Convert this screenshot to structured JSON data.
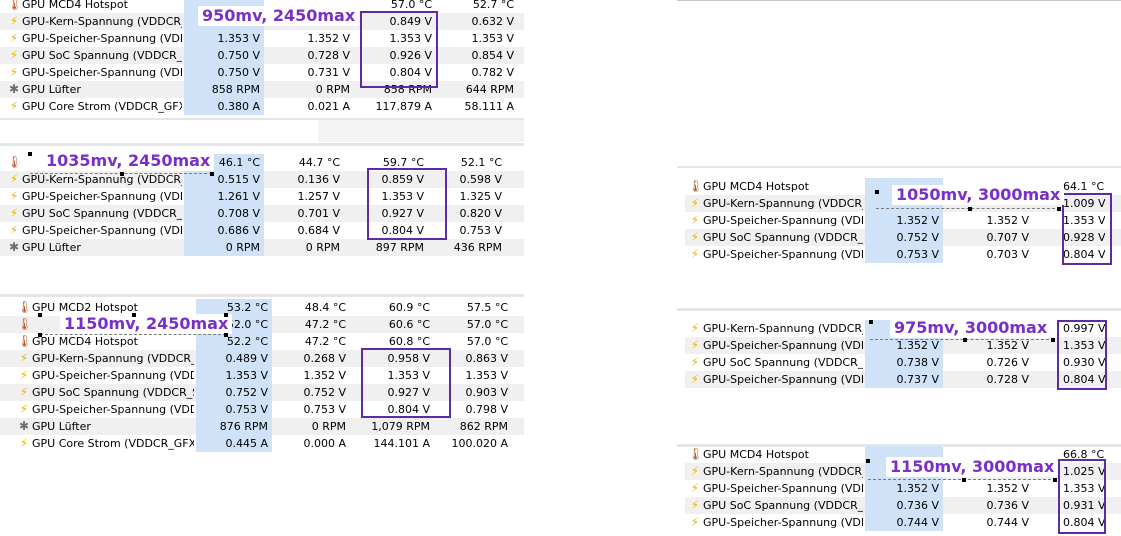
{
  "colors": {
    "accent_box": "#5e2ba8",
    "annotation_text": "#7a2fc8",
    "selection_fill": "#cfe2f7",
    "row_alt": "#f0f0f0"
  },
  "icons": {
    "voltage": "bolt-icon",
    "temperature": "thermometer-icon",
    "fan": "fan-icon"
  },
  "panels": {
    "p1": {
      "annotation": "950mv, 2450max",
      "rows": [
        {
          "name": "GPU MCD4 Hotspot",
          "v1": "",
          "v2": "",
          "v3": "57.0 °C",
          "v4": "52.7 °C"
        },
        {
          "name": "GPU-Kern-Spannung (VDDCR_...",
          "v1": "",
          "v2": "",
          "v3": "0.849 V",
          "v4": "0.632 V"
        },
        {
          "name": "GPU-Speicher-Spannung (VDDIO)",
          "v1": "1.353 V",
          "v2": "1.352 V",
          "v3": "1.353 V",
          "v4": "1.353 V"
        },
        {
          "name": "GPU SoC Spannung (VDDCR_S...",
          "v1": "0.750 V",
          "v2": "0.728 V",
          "v3": "0.926 V",
          "v4": "0.854 V"
        },
        {
          "name": "GPU-Speicher-Spannung (VDD...",
          "v1": "0.750 V",
          "v2": "0.731 V",
          "v3": "0.804 V",
          "v4": "0.782 V"
        },
        {
          "name": "GPU Lüfter",
          "v1": "858 RPM",
          "v2": "0 RPM",
          "v3": "858 RPM",
          "v4": "644 RPM"
        },
        {
          "name": "GPU Core Strom (VDDCR_GFX)",
          "v1": "0.380 A",
          "v2": "0.021 A",
          "v3": "117.879 A",
          "v4": "58.111 A"
        }
      ]
    },
    "p2": {
      "annotation": "1035mv, 2450max",
      "rows": [
        {
          "name": "",
          "v1": "46.1 °C",
          "v2": "44.7 °C",
          "v3": "59.7 °C",
          "v4": "52.1 °C"
        },
        {
          "name": "GPU-Kern-Spannung (VDDCR_...",
          "v1": "0.515 V",
          "v2": "0.136 V",
          "v3": "0.859 V",
          "v4": "0.598 V"
        },
        {
          "name": "GPU-Speicher-Spannung (VDDIO)",
          "v1": "1.261 V",
          "v2": "1.257 V",
          "v3": "1.353 V",
          "v4": "1.325 V"
        },
        {
          "name": "GPU SoC Spannung (VDDCR_S...",
          "v1": "0.708 V",
          "v2": "0.701 V",
          "v3": "0.927 V",
          "v4": "0.820 V"
        },
        {
          "name": "GPU-Speicher-Spannung (VDD...",
          "v1": "0.686 V",
          "v2": "0.684 V",
          "v3": "0.804 V",
          "v4": "0.753 V"
        },
        {
          "name": "GPU Lüfter",
          "v1": "0 RPM",
          "v2": "0 RPM",
          "v3": "897 RPM",
          "v4": "436 RPM"
        }
      ]
    },
    "p3": {
      "annotation": "1150mv, 2450max",
      "rows": [
        {
          "name": "GPU MCD2 Hotspot",
          "v1": "53.2 °C",
          "v2": "48.4 °C",
          "v3": "60.9 °C",
          "v4": "57.5 °C"
        },
        {
          "name": "",
          "v1": "52.0 °C",
          "v2": "47.2 °C",
          "v3": "60.6 °C",
          "v4": "57.0 °C"
        },
        {
          "name": "GPU MCD4 Hotspot",
          "v1": "52.2 °C",
          "v2": "47.2 °C",
          "v3": "60.8 °C",
          "v4": "57.0 °C"
        },
        {
          "name": "GPU-Kern-Spannung (VDDCR_...",
          "v1": "0.489 V",
          "v2": "0.268 V",
          "v3": "0.958 V",
          "v4": "0.863 V"
        },
        {
          "name": "GPU-Speicher-Spannung (VDDIO)",
          "v1": "1.353 V",
          "v2": "1.352 V",
          "v3": "1.353 V",
          "v4": "1.353 V"
        },
        {
          "name": "GPU SoC Spannung (VDDCR_S...",
          "v1": "0.752 V",
          "v2": "0.752 V",
          "v3": "0.927 V",
          "v4": "0.903 V"
        },
        {
          "name": "GPU-Speicher-Spannung (VDD...",
          "v1": "0.753 V",
          "v2": "0.753 V",
          "v3": "0.804 V",
          "v4": "0.798 V"
        },
        {
          "name": "GPU Lüfter",
          "v1": "876 RPM",
          "v2": "0 RPM",
          "v3": "1,079 RPM",
          "v4": "862 RPM"
        },
        {
          "name": "GPU Core Strom (VDDCR_GFX)",
          "v1": "0.445 A",
          "v2": "0.000 A",
          "v3": "144.101 A",
          "v4": "100.020 A"
        }
      ]
    },
    "p4": {
      "annotation": "1050mv, 3000max",
      "rows": [
        {
          "name": "GPU MCD4 Hotspot",
          "v1": "",
          "v2": "",
          "v3": "",
          "v4": "64.1 °C"
        },
        {
          "name": "GPU-Kern-Spannung (VDDCR_...",
          "v1": "",
          "v2": "",
          "v3": "",
          "v4": "1.009 V"
        },
        {
          "name": "GPU-Speicher-Spannung (VDDIO)",
          "v1": "1.352 V",
          "v2": "1.352 V",
          "v3": "",
          "v4": "1.353 V"
        },
        {
          "name": "GPU SoC Spannung (VDDCR_S...",
          "v1": "0.752 V",
          "v2": "0.707 V",
          "v3": "",
          "v4": "0.928 V"
        },
        {
          "name": "GPU-Speicher-Spannung (VDD...",
          "v1": "0.753 V",
          "v2": "0.703 V",
          "v3": "",
          "v4": "0.804 V"
        }
      ]
    },
    "p5": {
      "annotation": "975mv, 3000max",
      "rows": [
        {
          "name": "GPU-Kern-Spannung (VDDCR_...",
          "v1": "",
          "v2": "",
          "v3": "",
          "v4": "0.997 V"
        },
        {
          "name": "GPU-Speicher-Spannung (VDDIO)",
          "v1": "1.352 V",
          "v2": "1.352 V",
          "v3": "",
          "v4": "1.353 V"
        },
        {
          "name": "GPU SoC Spannung (VDDCR_S...",
          "v1": "0.738 V",
          "v2": "0.726 V",
          "v3": "",
          "v4": "0.930 V"
        },
        {
          "name": "GPU-Speicher-Spannung (VDD...",
          "v1": "0.737 V",
          "v2": "0.728 V",
          "v3": "",
          "v4": "0.804 V"
        }
      ]
    },
    "p6": {
      "annotation": "1150mv, 3000max",
      "rows": [
        {
          "name": "GPU MCD4 Hotspot",
          "v1": "",
          "v2": "",
          "v3": "",
          "v4": "66.8 °C"
        },
        {
          "name": "GPU-Kern-Spannung (VDDCR_...",
          "v1": "",
          "v2": "",
          "v3": "",
          "v4": "1.025 V"
        },
        {
          "name": "GPU-Speicher-Spannung (VDDIO)",
          "v1": "1.352 V",
          "v2": "1.352 V",
          "v3": "",
          "v4": "1.353 V"
        },
        {
          "name": "GPU SoC Spannung (VDDCR_S...",
          "v1": "0.736 V",
          "v2": "0.736 V",
          "v3": "",
          "v4": "0.931 V"
        },
        {
          "name": "GPU-Speicher-Spannung (VDD...",
          "v1": "0.744 V",
          "v2": "0.744 V",
          "v3": "",
          "v4": "0.804 V"
        }
      ]
    }
  }
}
